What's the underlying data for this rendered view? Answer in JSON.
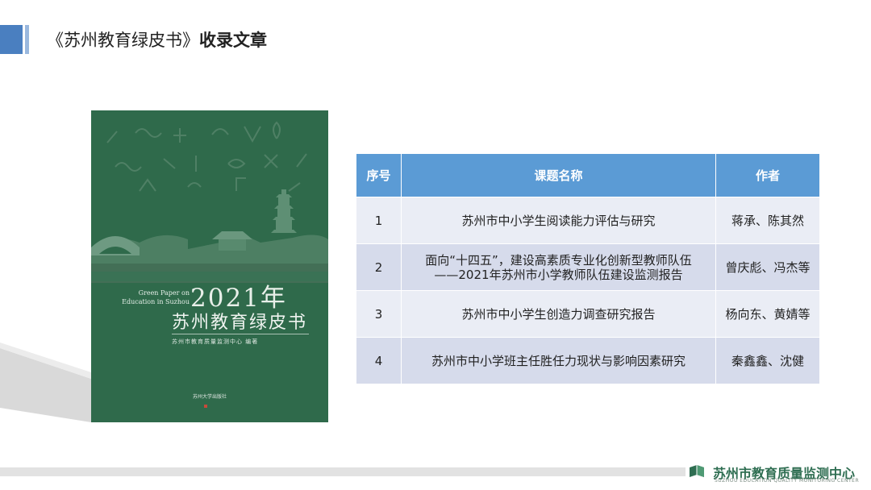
{
  "header": {
    "title_main": "《苏州教育绿皮书》",
    "title_bold": "收录文章"
  },
  "book": {
    "english_line1": "Green Paper on",
    "english_line2": "Education in Suzhou",
    "year": "2021年",
    "title": "苏州教育绿皮书",
    "editor": "苏州市教育质量监测中心 编著",
    "press": "苏州大学出版社"
  },
  "table": {
    "headers": [
      "序号",
      "课题名称",
      "作者"
    ],
    "rows": [
      {
        "no": "1",
        "title_line1": "苏州市中小学生阅读能力评估与研究",
        "title_line2": "",
        "author": "蒋承、陈其然"
      },
      {
        "no": "2",
        "title_line1": "面向“十四五”，建设高素质专业化创新型教师队伍",
        "title_line2": "——2021年苏州市小学教师队伍建设监测报告",
        "author": "曾庆彪、冯杰等"
      },
      {
        "no": "3",
        "title_line1": "苏州市中小学生创造力调查研究报告",
        "title_line2": "",
        "author": "杨向东、黄婧等"
      },
      {
        "no": "4",
        "title_line1": "苏州市中小学班主任胜任力现状与影响因素研究",
        "title_line2": "",
        "author": "秦鑫鑫、沈健"
      }
    ]
  },
  "footer": {
    "org_name": "苏州市教育质量监测中心",
    "org_name_en": "SUZHOU EDUCATION QUALITY MONITORING CENTER",
    "logo_icon": "book-icon"
  },
  "colors": {
    "accent": "#4a7fc0",
    "table_header": "#5b9bd5",
    "row_light": "#eaedf5",
    "row_dark": "#d6dbeb",
    "book_green": "#2f6a4b",
    "brand_green": "#2f6e52"
  }
}
